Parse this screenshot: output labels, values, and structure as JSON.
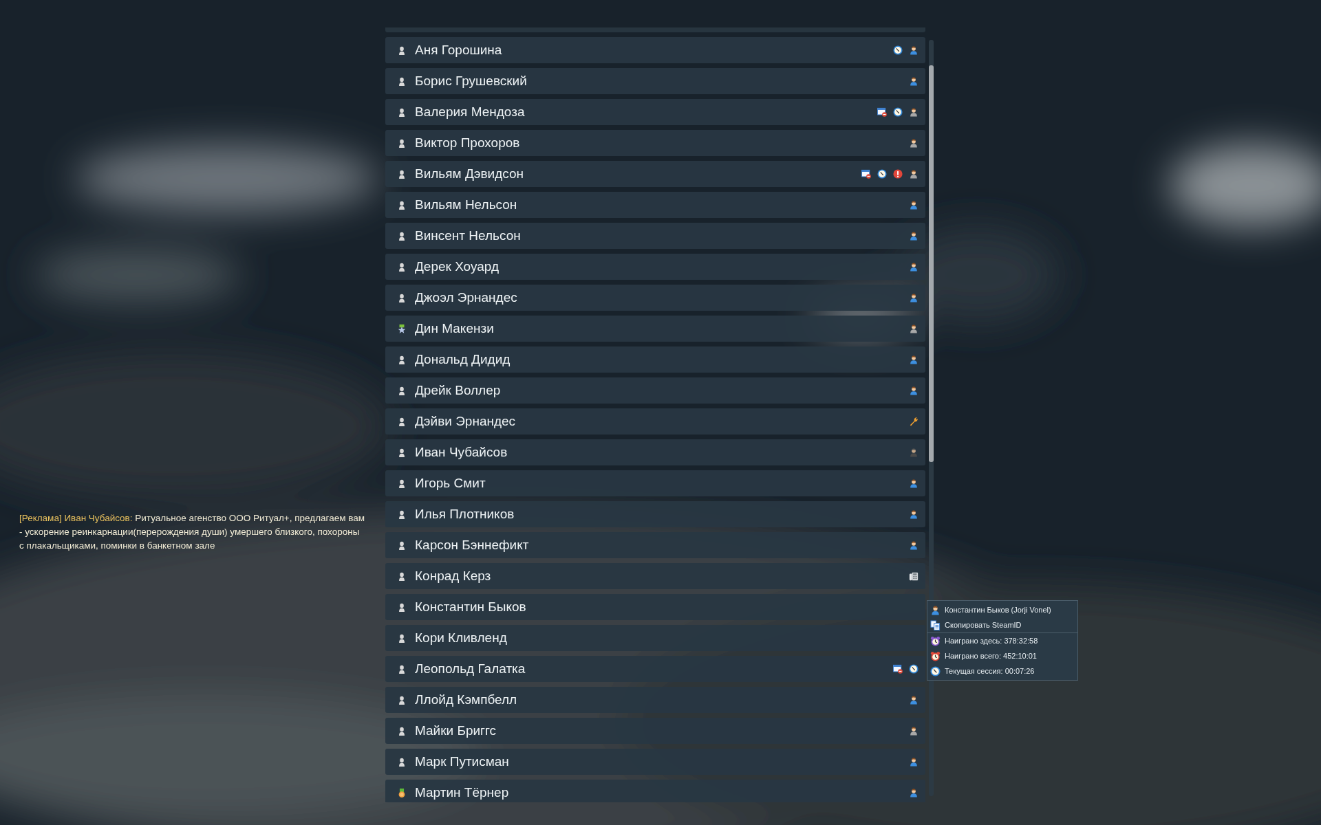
{
  "players": [
    {
      "kind": "user",
      "name": "Аня Горошина",
      "icons": [
        {
          "kind": "clock"
        },
        {
          "kind": "user-blue"
        }
      ]
    },
    {
      "kind": "user",
      "name": "Борис Грушевский",
      "icons": [
        {
          "kind": "user-blue"
        }
      ]
    },
    {
      "kind": "user",
      "name": "Валерия Мендоза",
      "icons": [
        {
          "kind": "ban"
        },
        {
          "kind": "clock"
        },
        {
          "kind": "user-gray"
        }
      ]
    },
    {
      "kind": "user",
      "name": "Виктор Прохоров",
      "icons": [
        {
          "kind": "user-gray"
        }
      ]
    },
    {
      "kind": "user",
      "name": "Вильям Дэвидсон",
      "icons": [
        {
          "kind": "ban"
        },
        {
          "kind": "clock"
        },
        {
          "kind": "alert"
        },
        {
          "kind": "user-gray"
        }
      ]
    },
    {
      "kind": "user",
      "name": "Вильям Нельсон",
      "icons": [
        {
          "kind": "user-blue"
        }
      ]
    },
    {
      "kind": "user",
      "name": "Винсент Нельсон",
      "icons": [
        {
          "kind": "user-blue"
        }
      ]
    },
    {
      "kind": "user",
      "name": "Дерек Хоуард",
      "icons": [
        {
          "kind": "user-blue"
        }
      ]
    },
    {
      "kind": "user",
      "name": "Джоэл Эрнандес",
      "icons": [
        {
          "kind": "user-blue"
        }
      ]
    },
    {
      "kind": "star",
      "name": "Дин Макензи",
      "icons": [
        {
          "kind": "user-gray"
        }
      ]
    },
    {
      "kind": "user",
      "name": "Дональд Дидид",
      "icons": [
        {
          "kind": "user-blue"
        }
      ]
    },
    {
      "kind": "user",
      "name": "Дрейк Воллер",
      "icons": [
        {
          "kind": "user-blue"
        }
      ]
    },
    {
      "kind": "user",
      "name": "Дэйви Эрнандес",
      "icons": [
        {
          "kind": "wrench"
        }
      ]
    },
    {
      "kind": "user",
      "name": "Иван Чубайсов",
      "icons": [
        {
          "kind": "user-dark"
        }
      ]
    },
    {
      "kind": "user",
      "name": "Игорь Смит",
      "icons": [
        {
          "kind": "user-blue"
        }
      ]
    },
    {
      "kind": "user",
      "name": "Илья Плотников",
      "icons": [
        {
          "kind": "user-blue"
        }
      ]
    },
    {
      "kind": "user",
      "name": "Карсон Бэннефикт",
      "icons": [
        {
          "kind": "user-blue"
        }
      ]
    },
    {
      "kind": "user",
      "name": "Конрад Керз",
      "icons": [
        {
          "kind": "phone"
        }
      ]
    },
    {
      "kind": "user",
      "name": "Константин Быков"
    },
    {
      "kind": "user",
      "name": "Кори Кливленд"
    },
    {
      "kind": "user",
      "name": "Леопольд Галатка",
      "icons": [
        {
          "kind": "ban"
        },
        {
          "kind": "clock"
        }
      ]
    },
    {
      "kind": "user",
      "name": "Ллойд Кэмпбелл",
      "icons": [
        {
          "kind": "user-blue"
        }
      ]
    },
    {
      "kind": "user",
      "name": "Майки Бриггс",
      "icons": [
        {
          "kind": "user-gray"
        }
      ]
    },
    {
      "kind": "user",
      "name": "Марк Путисман",
      "icons": [
        {
          "kind": "user-blue"
        }
      ]
    },
    {
      "kind": "medal",
      "name": "Мартин Тёрнер",
      "icons": [
        {
          "kind": "user-blue"
        }
      ]
    }
  ],
  "context_menu": {
    "sections": [
      [
        {
          "kind": "user-blue",
          "text": "Константин Быков (Jorji Vonel)"
        },
        {
          "kind": "copy",
          "text": "Скопировать SteamID"
        }
      ],
      [
        {
          "kind": "alarm-purple",
          "text": "Наиграно здесь: 378:32:58"
        },
        {
          "kind": "alarm-red",
          "text": "Наиграно всего: 452:10:01"
        },
        {
          "kind": "clock",
          "text": "Текущая сессия: 00:07:26"
        }
      ]
    ]
  },
  "chat_message": {
    "tag": "[Реклама] Иван Чубайсов:",
    "lines": [
      "Ритуальное агенство ООО Ритуал+, предлагаем вам",
      "- ускорение реинкарнации(перерождения души) умершего близкого, похороны",
      "с плакальщиками, поминки в банкетном зале"
    ]
  }
}
